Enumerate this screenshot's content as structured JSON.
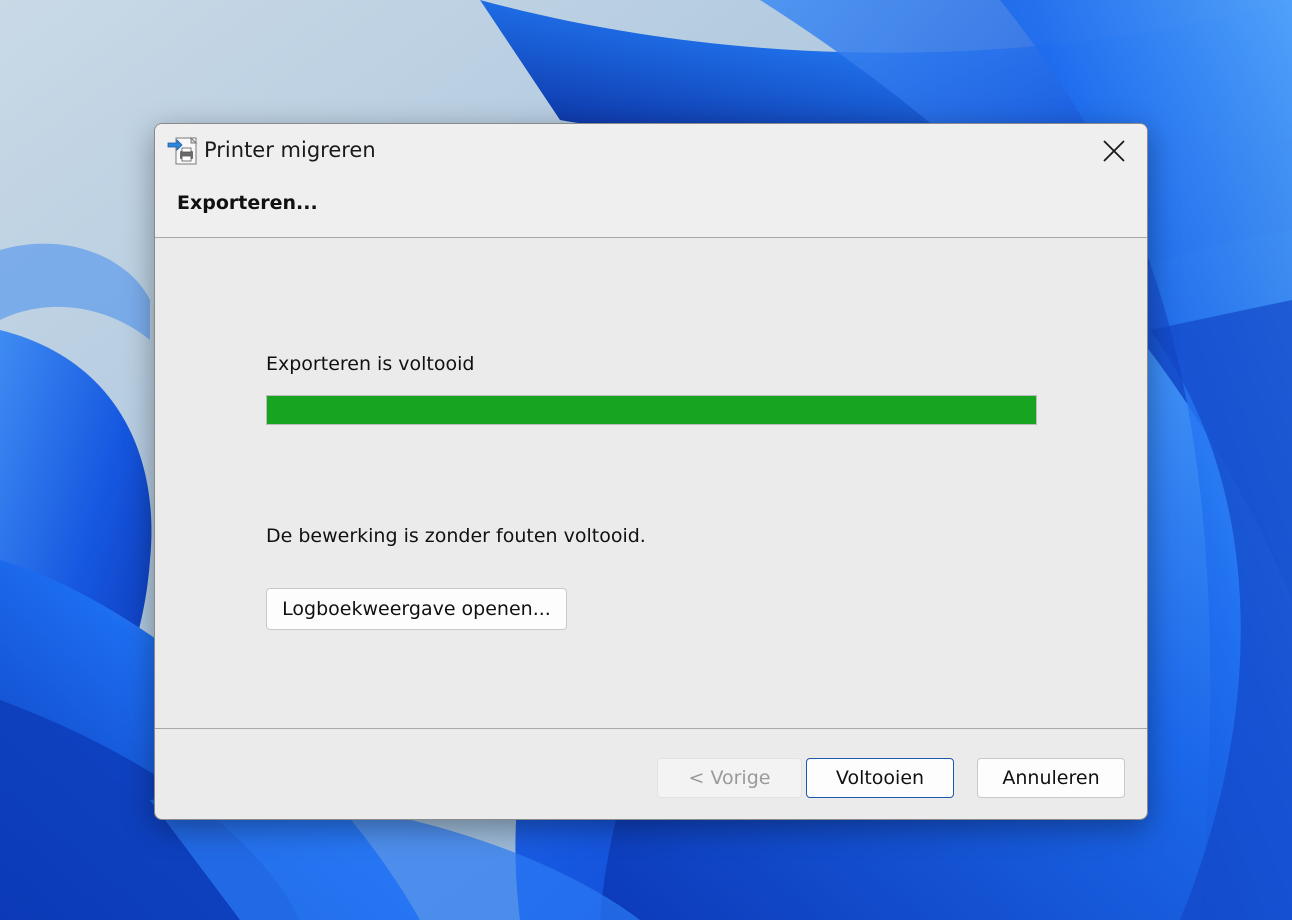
{
  "window": {
    "title": "Printer migreren",
    "icon": "printer-migration-icon",
    "close_icon": "close-icon"
  },
  "header": {
    "title": "Exporteren..."
  },
  "progress": {
    "label": "Exporteren is voltooid",
    "percent": 100,
    "color": "#17a521"
  },
  "result": {
    "message": "De bewerking is zonder fouten voltooid."
  },
  "buttons": {
    "open_log": "Logboekweergave openen...",
    "back": "< Vorige",
    "back_enabled": false,
    "finish": "Voltooien",
    "cancel": "Annuleren"
  },
  "colors": {
    "accent": "#1b5aa8",
    "progress_green": "#17a521",
    "dialog_bg": "#ebebeb"
  }
}
